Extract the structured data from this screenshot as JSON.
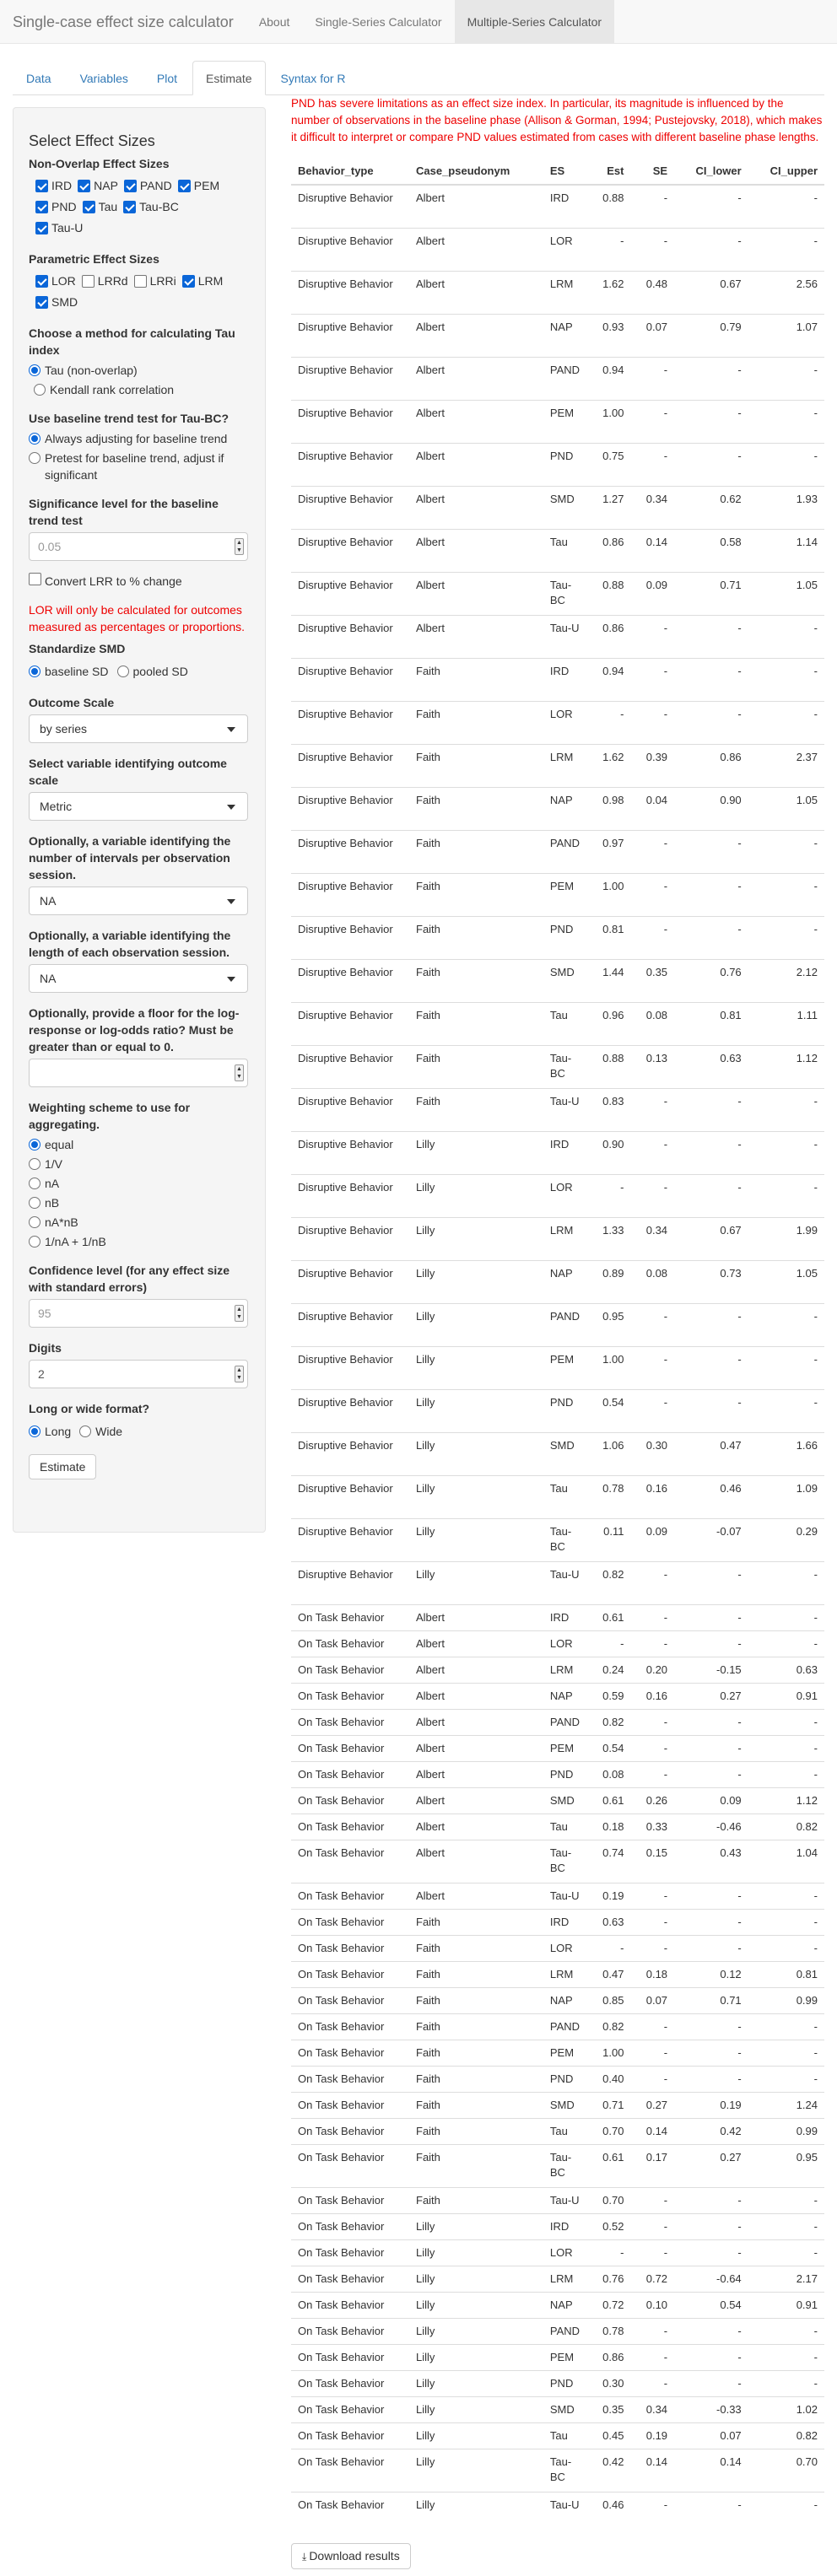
{
  "app": {
    "brand": "Single-case effect size calculator",
    "nav": [
      "About",
      "Single-Series Calculator",
      "Multiple-Series Calculator"
    ],
    "active_nav": 2
  },
  "tabs": [
    "Data",
    "Variables",
    "Plot",
    "Estimate",
    "Syntax for R"
  ],
  "active_tab": 3,
  "sidebar": {
    "title": "Select Effect Sizes",
    "nonoverlap_label": "Non-Overlap Effect Sizes",
    "nonoverlap": [
      {
        "label": "IRD",
        "checked": true
      },
      {
        "label": "NAP",
        "checked": true
      },
      {
        "label": "PAND",
        "checked": true
      },
      {
        "label": "PEM",
        "checked": true
      },
      {
        "label": "PND",
        "checked": true
      },
      {
        "label": "Tau",
        "checked": true
      },
      {
        "label": "Tau-BC",
        "checked": true
      },
      {
        "label": "Tau-U",
        "checked": true
      }
    ],
    "parametric_label": "Parametric Effect Sizes",
    "parametric": [
      {
        "label": "LOR",
        "checked": true
      },
      {
        "label": "LRRd",
        "checked": false
      },
      {
        "label": "LRRi",
        "checked": false
      },
      {
        "label": "LRM",
        "checked": true
      },
      {
        "label": "SMD",
        "checked": true
      }
    ],
    "tau_method_label": "Choose a method for calculating Tau index",
    "tau_method_options": [
      "Tau (non-overlap)",
      "Kendall rank correlation"
    ],
    "tau_method_selected": 0,
    "baseline_trend_label": "Use baseline trend test for Tau-BC?",
    "baseline_trend_options": [
      "Always adjusting for baseline trend",
      "Pretest for baseline trend, adjust if significant"
    ],
    "baseline_trend_selected": 0,
    "significance_label": "Significance level for the baseline trend test",
    "significance_value": "0.05",
    "convert_lrr_label": "Convert LRR to % change",
    "lor_warning": "LOR will only be calculated for outcomes measured as percentages or proportions.",
    "standardize_label": "Standardize SMD",
    "standardize_options": [
      "baseline SD",
      "pooled SD"
    ],
    "standardize_selected": 0,
    "outcome_scale_label": "Outcome Scale",
    "outcome_scale_value": "by series",
    "variable_scale_label": "Select variable identifying outcome scale",
    "variable_scale_value": "Metric",
    "intervals_label": "Optionally, a variable identifying the number of intervals per observation session.",
    "intervals_value": "NA",
    "length_label": "Optionally, a variable identifying the length of each observation session.",
    "length_value": "NA",
    "floor_label": "Optionally, provide a floor for the log-response or log-odds ratio? Must be greater than or equal to 0.",
    "floor_value": "",
    "weighting_label": "Weighting scheme to use for aggregating.",
    "weighting_options": [
      "equal",
      "1/V",
      "nA",
      "nB",
      "nA*nB",
      "1/nA + 1/nB"
    ],
    "weighting_selected": 0,
    "confidence_label": "Confidence level (for any effect size with standard errors)",
    "confidence_value": "95",
    "digits_label": "Digits",
    "digits_value": "2",
    "format_label": "Long or wide format?",
    "format_options": [
      "Long",
      "Wide"
    ],
    "format_selected": 0,
    "estimate_button": "Estimate"
  },
  "main": {
    "pnd_warning": "PND has severe limitations as an effect size index. In particular, its magnitude is influenced by the number of observations in the baseline phase (Allison & Gorman, 1994; Pustejovsky, 2018), which makes it difficult to interpret or compare PND values estimated from cases with different baseline phase lengths.",
    "columns": [
      "Behavior_type",
      "Case_pseudonym",
      "ES",
      "Est",
      "SE",
      "CI_lower",
      "CI_upper"
    ],
    "rows": [
      [
        "Disruptive Behavior",
        "Albert",
        "IRD",
        "0.88",
        "-",
        "-",
        "-"
      ],
      [
        "Disruptive Behavior",
        "Albert",
        "LOR",
        "-",
        "-",
        "-",
        "-"
      ],
      [
        "Disruptive Behavior",
        "Albert",
        "LRM",
        "1.62",
        "0.48",
        "0.67",
        "2.56"
      ],
      [
        "Disruptive Behavior",
        "Albert",
        "NAP",
        "0.93",
        "0.07",
        "0.79",
        "1.07"
      ],
      [
        "Disruptive Behavior",
        "Albert",
        "PAND",
        "0.94",
        "-",
        "-",
        "-"
      ],
      [
        "Disruptive Behavior",
        "Albert",
        "PEM",
        "1.00",
        "-",
        "-",
        "-"
      ],
      [
        "Disruptive Behavior",
        "Albert",
        "PND",
        "0.75",
        "-",
        "-",
        "-"
      ],
      [
        "Disruptive Behavior",
        "Albert",
        "SMD",
        "1.27",
        "0.34",
        "0.62",
        "1.93"
      ],
      [
        "Disruptive Behavior",
        "Albert",
        "Tau",
        "0.86",
        "0.14",
        "0.58",
        "1.14"
      ],
      [
        "Disruptive Behavior",
        "Albert",
        "Tau-BC",
        "0.88",
        "0.09",
        "0.71",
        "1.05"
      ],
      [
        "Disruptive Behavior",
        "Albert",
        "Tau-U",
        "0.86",
        "-",
        "-",
        "-"
      ],
      [
        "Disruptive Behavior",
        "Faith",
        "IRD",
        "0.94",
        "-",
        "-",
        "-"
      ],
      [
        "Disruptive Behavior",
        "Faith",
        "LOR",
        "-",
        "-",
        "-",
        "-"
      ],
      [
        "Disruptive Behavior",
        "Faith",
        "LRM",
        "1.62",
        "0.39",
        "0.86",
        "2.37"
      ],
      [
        "Disruptive Behavior",
        "Faith",
        "NAP",
        "0.98",
        "0.04",
        "0.90",
        "1.05"
      ],
      [
        "Disruptive Behavior",
        "Faith",
        "PAND",
        "0.97",
        "-",
        "-",
        "-"
      ],
      [
        "Disruptive Behavior",
        "Faith",
        "PEM",
        "1.00",
        "-",
        "-",
        "-"
      ],
      [
        "Disruptive Behavior",
        "Faith",
        "PND",
        "0.81",
        "-",
        "-",
        "-"
      ],
      [
        "Disruptive Behavior",
        "Faith",
        "SMD",
        "1.44",
        "0.35",
        "0.76",
        "2.12"
      ],
      [
        "Disruptive Behavior",
        "Faith",
        "Tau",
        "0.96",
        "0.08",
        "0.81",
        "1.11"
      ],
      [
        "Disruptive Behavior",
        "Faith",
        "Tau-BC",
        "0.88",
        "0.13",
        "0.63",
        "1.12"
      ],
      [
        "Disruptive Behavior",
        "Faith",
        "Tau-U",
        "0.83",
        "-",
        "-",
        "-"
      ],
      [
        "Disruptive Behavior",
        "Lilly",
        "IRD",
        "0.90",
        "-",
        "-",
        "-"
      ],
      [
        "Disruptive Behavior",
        "Lilly",
        "LOR",
        "-",
        "-",
        "-",
        "-"
      ],
      [
        "Disruptive Behavior",
        "Lilly",
        "LRM",
        "1.33",
        "0.34",
        "0.67",
        "1.99"
      ],
      [
        "Disruptive Behavior",
        "Lilly",
        "NAP",
        "0.89",
        "0.08",
        "0.73",
        "1.05"
      ],
      [
        "Disruptive Behavior",
        "Lilly",
        "PAND",
        "0.95",
        "-",
        "-",
        "-"
      ],
      [
        "Disruptive Behavior",
        "Lilly",
        "PEM",
        "1.00",
        "-",
        "-",
        "-"
      ],
      [
        "Disruptive Behavior",
        "Lilly",
        "PND",
        "0.54",
        "-",
        "-",
        "-"
      ],
      [
        "Disruptive Behavior",
        "Lilly",
        "SMD",
        "1.06",
        "0.30",
        "0.47",
        "1.66"
      ],
      [
        "Disruptive Behavior",
        "Lilly",
        "Tau",
        "0.78",
        "0.16",
        "0.46",
        "1.09"
      ],
      [
        "Disruptive Behavior",
        "Lilly",
        "Tau-BC",
        "0.11",
        "0.09",
        "-0.07",
        "0.29"
      ],
      [
        "Disruptive Behavior",
        "Lilly",
        "Tau-U",
        "0.82",
        "-",
        "-",
        "-"
      ],
      [
        "On Task Behavior",
        "Albert",
        "IRD",
        "0.61",
        "-",
        "-",
        "-"
      ],
      [
        "On Task Behavior",
        "Albert",
        "LOR",
        "-",
        "-",
        "-",
        "-"
      ],
      [
        "On Task Behavior",
        "Albert",
        "LRM",
        "0.24",
        "0.20",
        "-0.15",
        "0.63"
      ],
      [
        "On Task Behavior",
        "Albert",
        "NAP",
        "0.59",
        "0.16",
        "0.27",
        "0.91"
      ],
      [
        "On Task Behavior",
        "Albert",
        "PAND",
        "0.82",
        "-",
        "-",
        "-"
      ],
      [
        "On Task Behavior",
        "Albert",
        "PEM",
        "0.54",
        "-",
        "-",
        "-"
      ],
      [
        "On Task Behavior",
        "Albert",
        "PND",
        "0.08",
        "-",
        "-",
        "-"
      ],
      [
        "On Task Behavior",
        "Albert",
        "SMD",
        "0.61",
        "0.26",
        "0.09",
        "1.12"
      ],
      [
        "On Task Behavior",
        "Albert",
        "Tau",
        "0.18",
        "0.33",
        "-0.46",
        "0.82"
      ],
      [
        "On Task Behavior",
        "Albert",
        "Tau-BC",
        "0.74",
        "0.15",
        "0.43",
        "1.04"
      ],
      [
        "On Task Behavior",
        "Albert",
        "Tau-U",
        "0.19",
        "-",
        "-",
        "-"
      ],
      [
        "On Task Behavior",
        "Faith",
        "IRD",
        "0.63",
        "-",
        "-",
        "-"
      ],
      [
        "On Task Behavior",
        "Faith",
        "LOR",
        "-",
        "-",
        "-",
        "-"
      ],
      [
        "On Task Behavior",
        "Faith",
        "LRM",
        "0.47",
        "0.18",
        "0.12",
        "0.81"
      ],
      [
        "On Task Behavior",
        "Faith",
        "NAP",
        "0.85",
        "0.07",
        "0.71",
        "0.99"
      ],
      [
        "On Task Behavior",
        "Faith",
        "PAND",
        "0.82",
        "-",
        "-",
        "-"
      ],
      [
        "On Task Behavior",
        "Faith",
        "PEM",
        "1.00",
        "-",
        "-",
        "-"
      ],
      [
        "On Task Behavior",
        "Faith",
        "PND",
        "0.40",
        "-",
        "-",
        "-"
      ],
      [
        "On Task Behavior",
        "Faith",
        "SMD",
        "0.71",
        "0.27",
        "0.19",
        "1.24"
      ],
      [
        "On Task Behavior",
        "Faith",
        "Tau",
        "0.70",
        "0.14",
        "0.42",
        "0.99"
      ],
      [
        "On Task Behavior",
        "Faith",
        "Tau-BC",
        "0.61",
        "0.17",
        "0.27",
        "0.95"
      ],
      [
        "On Task Behavior",
        "Faith",
        "Tau-U",
        "0.70",
        "-",
        "-",
        "-"
      ],
      [
        "On Task Behavior",
        "Lilly",
        "IRD",
        "0.52",
        "-",
        "-",
        "-"
      ],
      [
        "On Task Behavior",
        "Lilly",
        "LOR",
        "-",
        "-",
        "-",
        "-"
      ],
      [
        "On Task Behavior",
        "Lilly",
        "LRM",
        "0.76",
        "0.72",
        "-0.64",
        "2.17"
      ],
      [
        "On Task Behavior",
        "Lilly",
        "NAP",
        "0.72",
        "0.10",
        "0.54",
        "0.91"
      ],
      [
        "On Task Behavior",
        "Lilly",
        "PAND",
        "0.78",
        "-",
        "-",
        "-"
      ],
      [
        "On Task Behavior",
        "Lilly",
        "PEM",
        "0.86",
        "-",
        "-",
        "-"
      ],
      [
        "On Task Behavior",
        "Lilly",
        "PND",
        "0.30",
        "-",
        "-",
        "-"
      ],
      [
        "On Task Behavior",
        "Lilly",
        "SMD",
        "0.35",
        "0.34",
        "-0.33",
        "1.02"
      ],
      [
        "On Task Behavior",
        "Lilly",
        "Tau",
        "0.45",
        "0.19",
        "0.07",
        "0.82"
      ],
      [
        "On Task Behavior",
        "Lilly",
        "Tau-BC",
        "0.42",
        "0.14",
        "0.14",
        "0.70"
      ],
      [
        "On Task Behavior",
        "Lilly",
        "Tau-U",
        "0.46",
        "-",
        "-",
        "-"
      ]
    ],
    "download_button": "Download results",
    "download_icon": "download-icon"
  }
}
